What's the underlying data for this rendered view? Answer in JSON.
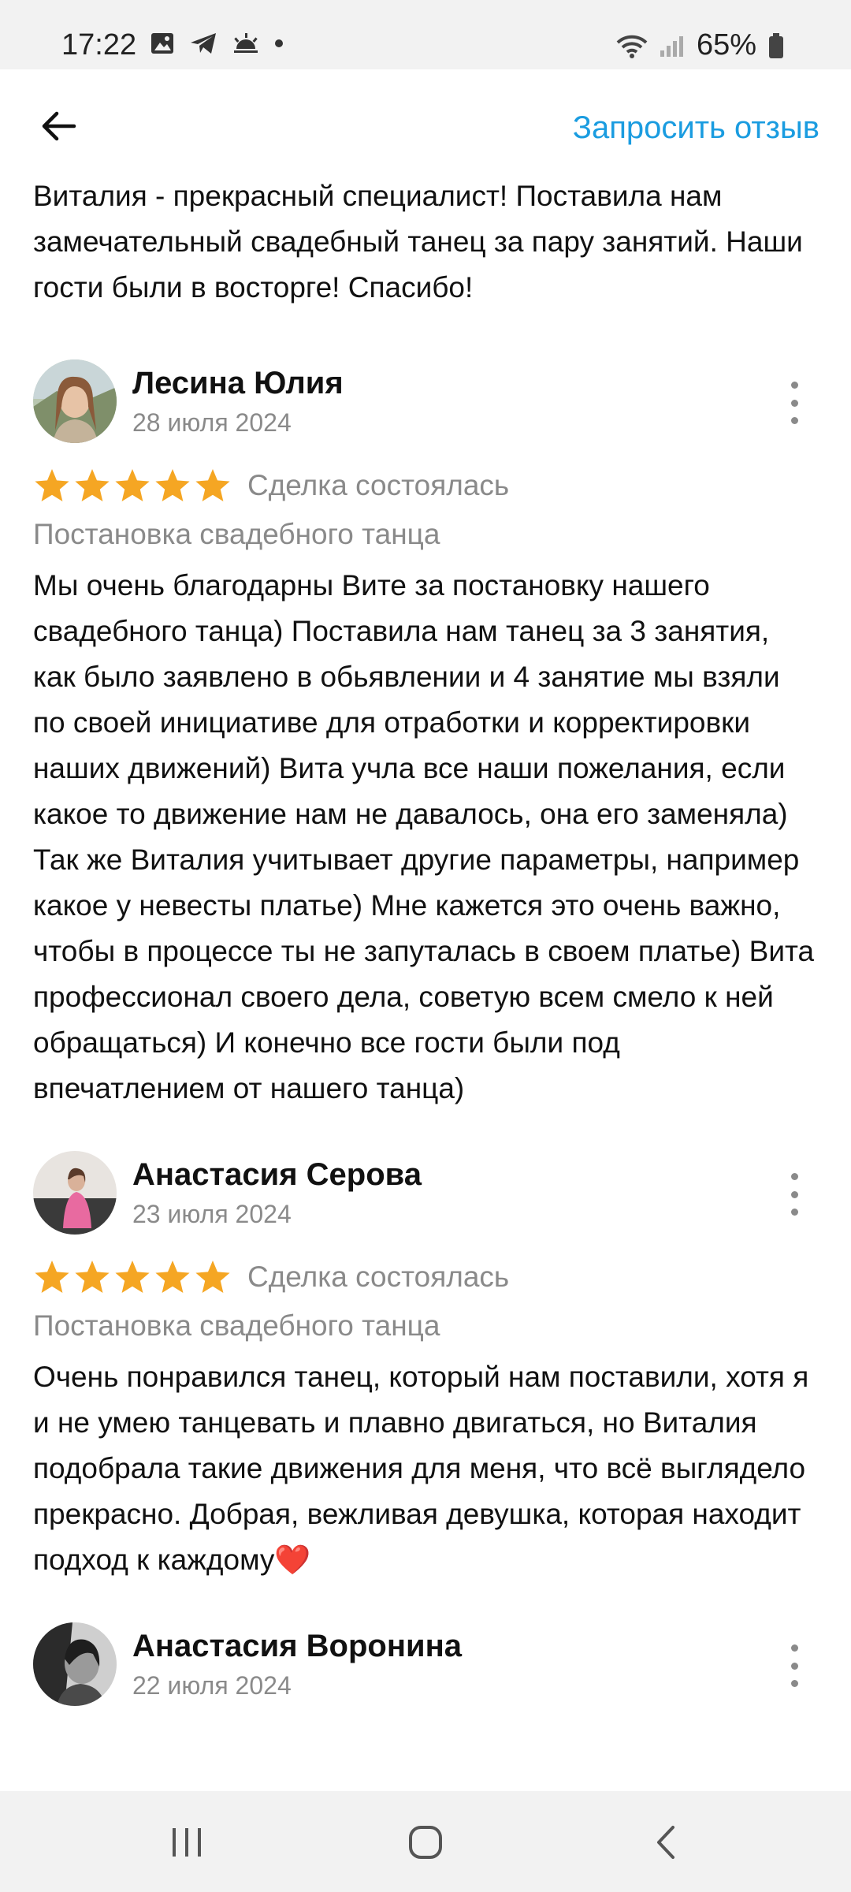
{
  "status_bar": {
    "time": "17:22",
    "battery": "65%"
  },
  "header": {
    "request_review": "Запросить отзыв"
  },
  "intro_text": "Виталия - прекрасный специалист! Поставила нам замечательный свадебный танец за пару занятий. Наши гости были в восторге! Спасибо!",
  "reviews": [
    {
      "name": "Лесина Юлия",
      "date": "28 июля 2024",
      "stars": 5,
      "status": "Сделка состоялась",
      "service": "Постановка свадебного танца",
      "text": "Мы очень благодарны Вите за постановку нашего свадебного танца) Поставила нам танец за 3 занятия, как было заявлено в обьявлении и 4 занятие мы взяли по своей инициативе для отработки и корректировки наших движений) Вита учла все наши пожелания, если какое то движение нам не давалось, она его заменяла) Так же Виталия учитывает другие параметры, например какое у невесты платье) Мне кажется это очень важно, чтобы в процессе ты не запуталась в своем платье) Вита профессионал своего дела, советую всем смело к ней обращаться) И конечно все гости были под впечатлением от нашего танца)"
    },
    {
      "name": "Анастасия Серова",
      "date": "23 июля 2024",
      "stars": 5,
      "status": "Сделка состоялась",
      "service": "Постановка свадебного танца",
      "text": "Очень понравился танец, который нам поставили, хотя я и не умею танцевать и плавно двигаться, но Виталия подобрала такие движения для меня, что всё выглядело прекрасно. Добрая, вежливая девушка, которая находит подход к каждому❤️"
    },
    {
      "name": "Анастасия Воронина",
      "date": "22 июля 2024"
    }
  ],
  "colors": {
    "accent": "#1a9ce0",
    "star": "#f5a623",
    "muted": "#8a8a8a"
  },
  "icons": [
    "back-arrow-icon",
    "more-vertical-icon",
    "star-icon",
    "recent-apps-icon",
    "home-icon",
    "nav-back-icon"
  ]
}
